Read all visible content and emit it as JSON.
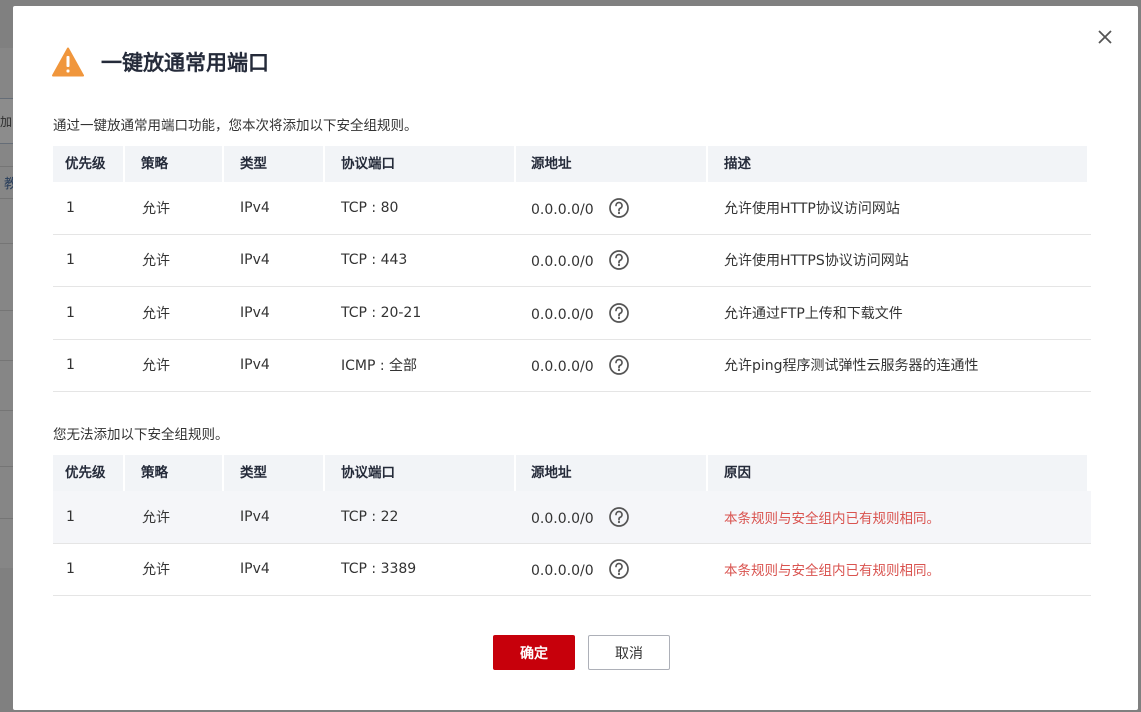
{
  "dialog": {
    "title": "一键放通常用端口",
    "intro": "通过一键放通常用端口功能，您本次将添加以下安全组规则。",
    "failed_intro": "您无法添加以下安全组规则。",
    "confirm_label": "确定",
    "cancel_label": "取消",
    "warning_color": "#f0963c",
    "accent_color": "#c7000b",
    "error_text_color": "#d9534f"
  },
  "add_table": {
    "headers": [
      "优先级",
      "策略",
      "类型",
      "协议端口",
      "源地址",
      "描述"
    ],
    "rows": [
      {
        "priority": "1",
        "policy": "允许",
        "type": "IPv4",
        "port": "TCP : 80",
        "source": "0.0.0.0/0",
        "desc": "允许使用HTTP协议访问网站"
      },
      {
        "priority": "1",
        "policy": "允许",
        "type": "IPv4",
        "port": "TCP : 443",
        "source": "0.0.0.0/0",
        "desc": "允许使用HTTPS协议访问网站"
      },
      {
        "priority": "1",
        "policy": "允许",
        "type": "IPv4",
        "port": "TCP : 20-21",
        "source": "0.0.0.0/0",
        "desc": "允许通过FTP上传和下载文件"
      },
      {
        "priority": "1",
        "policy": "允许",
        "type": "IPv4",
        "port": "ICMP : 全部",
        "source": "0.0.0.0/0",
        "desc": "允许ping程序测试弹性云服务器的连通性"
      }
    ]
  },
  "fail_table": {
    "headers": [
      "优先级",
      "策略",
      "类型",
      "协议端口",
      "源地址",
      "原因"
    ],
    "rows": [
      {
        "priority": "1",
        "policy": "允许",
        "type": "IPv4",
        "port": "TCP : 22",
        "source": "0.0.0.0/0",
        "desc": "本条规则与安全组内已有规则相同。"
      },
      {
        "priority": "1",
        "policy": "允许",
        "type": "IPv4",
        "port": "TCP : 3389",
        "source": "0.0.0.0/0",
        "desc": "本条规则与安全组内已有规则相同。"
      }
    ]
  },
  "background": {
    "edge_button": "加",
    "edge_text": "教"
  }
}
